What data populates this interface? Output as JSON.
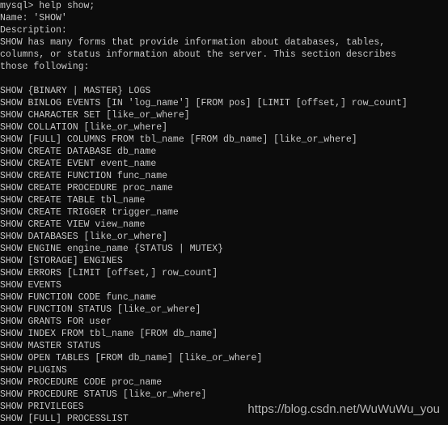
{
  "terminal": {
    "lines": [
      "mysql> help show;",
      "Name: 'SHOW'",
      "Description:",
      "SHOW has many forms that provide information about databases, tables,",
      "columns, or status information about the server. This section describes",
      "those following:",
      "",
      "SHOW {BINARY | MASTER} LOGS",
      "SHOW BINLOG EVENTS [IN 'log_name'] [FROM pos] [LIMIT [offset,] row_count]",
      "SHOW CHARACTER SET [like_or_where]",
      "SHOW COLLATION [like_or_where]",
      "SHOW [FULL] COLUMNS FROM tbl_name [FROM db_name] [like_or_where]",
      "SHOW CREATE DATABASE db_name",
      "SHOW CREATE EVENT event_name",
      "SHOW CREATE FUNCTION func_name",
      "SHOW CREATE PROCEDURE proc_name",
      "SHOW CREATE TABLE tbl_name",
      "SHOW CREATE TRIGGER trigger_name",
      "SHOW CREATE VIEW view_name",
      "SHOW DATABASES [like_or_where]",
      "SHOW ENGINE engine_name {STATUS | MUTEX}",
      "SHOW [STORAGE] ENGINES",
      "SHOW ERRORS [LIMIT [offset,] row_count]",
      "SHOW EVENTS",
      "SHOW FUNCTION CODE func_name",
      "SHOW FUNCTION STATUS [like_or_where]",
      "SHOW GRANTS FOR user",
      "SHOW INDEX FROM tbl_name [FROM db_name]",
      "SHOW MASTER STATUS",
      "SHOW OPEN TABLES [FROM db_name] [like_or_where]",
      "SHOW PLUGINS",
      "SHOW PROCEDURE CODE proc_name",
      "SHOW PROCEDURE STATUS [like_or_where]",
      "SHOW PRIVILEGES",
      "SHOW [FULL] PROCESSLIST"
    ]
  },
  "watermark": "https://blog.csdn.net/WuWuWu_you",
  "colors": {
    "background": "#0c0c0c",
    "text": "#c8c8c8"
  }
}
